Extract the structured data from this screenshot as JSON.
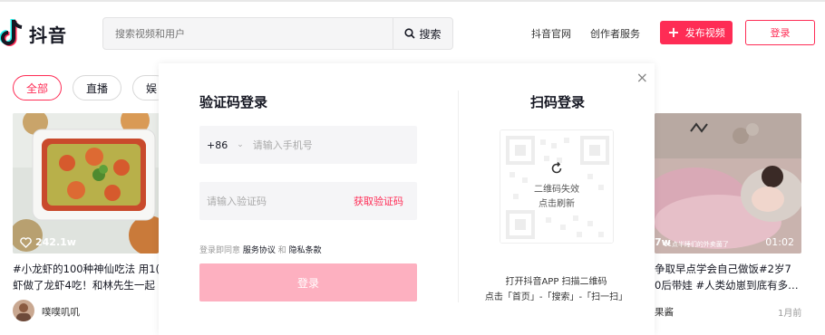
{
  "header": {
    "logo_text": "抖音",
    "search_placeholder": "搜索视频和用户",
    "search_button": "搜索",
    "nav": [
      "抖音官网",
      "创作者服务"
    ],
    "publish_label": "发布视频",
    "login_label": "登录"
  },
  "categories": [
    "全部",
    "直播",
    "娱"
  ],
  "cards": [
    {
      "likes": "242.1w",
      "title_line1": "#小龙虾的100种神仙吃法 用1(",
      "title_line2": "虾做了龙虾4吃！和林先生一起",
      "author": "噗噗叽叽"
    },
    {
      "likes": "7w",
      "duration": "01:02",
      "image_caption": "11点半睡们的外卖菌了",
      "title_line1": "争取早点学会自己做饭#2岁7",
      "title_line2": "0后带娃 #人类幼崽到底有多…",
      "author": "果酱",
      "time": "1月前"
    }
  ],
  "modal": {
    "close": "×",
    "sms_title": "验证码登录",
    "country_code": "+86",
    "phone_placeholder": "请输入手机号",
    "code_placeholder": "请输入验证码",
    "get_code": "获取验证码",
    "agree_prefix": "登录即同意",
    "agree_service": "服务协议",
    "agree_and": "和",
    "agree_privacy": "隐私条款",
    "login_button": "登录",
    "qr_title": "扫码登录",
    "qr_expired": "二维码失效",
    "qr_refresh": "点击刷新",
    "qr_tip1": "打开抖音APP 扫描二维码",
    "qr_tip2": "点击「首页」-「搜索」-「扫一扫」"
  },
  "colors": {
    "accent": "#fe2c55",
    "login_disabled": "#fdb0c0"
  }
}
